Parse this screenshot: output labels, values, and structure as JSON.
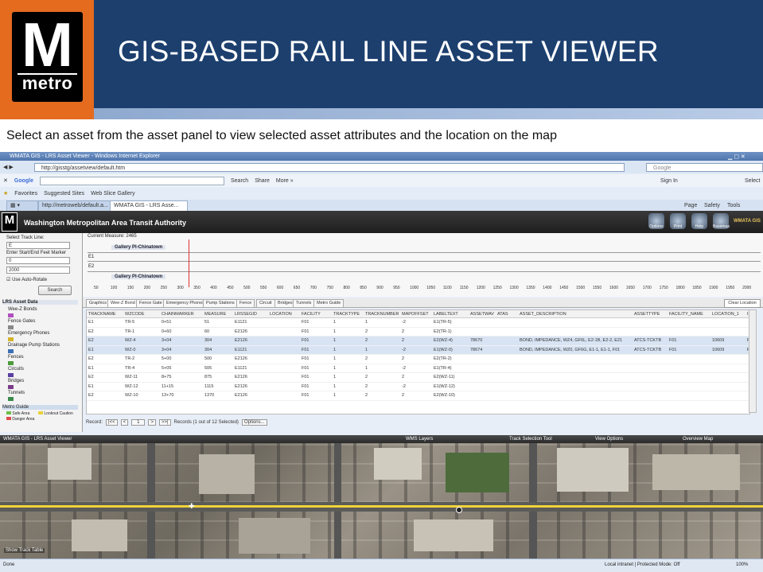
{
  "slide": {
    "title": "GIS-BASED RAIL LINE ASSET VIEWER",
    "subtitle": "Select an asset from the asset panel to view selected asset attributes and the location on the map",
    "logo": {
      "letter": "M",
      "word": "metro"
    },
    "colors": {
      "banner": "#1c3f6e",
      "orange": "#e56b1f",
      "light_bar": "#8fa9cf"
    }
  },
  "browser": {
    "window_title": "WMATA GIS - LRS Asset Viewer - Windows Internet Explorer",
    "address": "http://gisstg/assetview/default.htm",
    "search_placeholder": "Google",
    "google_bar": [
      "Google",
      "Search",
      "Share",
      "More »"
    ],
    "google_right": [
      "Sign In",
      "Select"
    ],
    "favorites": [
      "Favorites",
      "Suggested Sites",
      "Web Slice Gallery"
    ],
    "tabs": [
      "http://metroweb/default.a...",
      "WMATA GIS - LRS Asse..."
    ],
    "toolbar_right": [
      "Page",
      "Safety",
      "Tools"
    ]
  },
  "app": {
    "logo_letter": "M",
    "title": "Washington Metropolitan Area Transit Authority",
    "header_buttons": [
      "Options",
      "Print",
      "Help",
      "Basemap"
    ],
    "badge": "WMATA GIS"
  },
  "left_panel": {
    "select_track_label": "Select Track Line:",
    "track_value": "E",
    "marker_label": "Enter Start/End Feet Marker",
    "start_value": "0",
    "end_value": "2000",
    "auto_rotate": "Use Auto-Rotate",
    "search_btn": "Search",
    "assets_header": "LRS Asset Data",
    "legend": [
      {
        "label": "Wee-Z Bonds",
        "color": "#b14fc1"
      },
      {
        "label": "Fence Gates",
        "color": "#888888"
      },
      {
        "label": "Emergency Phones",
        "color": "#d4b32a"
      },
      {
        "label": "Drainage Pump Stations",
        "color": "#3a6fb5"
      },
      {
        "label": "Fences",
        "color": "#4a9b3a"
      },
      {
        "label": "Circuits",
        "color": "#5a3fa0"
      },
      {
        "label": "Bridges",
        "color": "#7a3a8a"
      },
      {
        "label": "Tunnels",
        "color": "#3a8a4a"
      }
    ],
    "metro_guide": "Metro Guide",
    "guide_items": [
      "Safe Area",
      "Lookout Caution",
      "Danger Area"
    ]
  },
  "track_panel": {
    "current_measure": "Current Measure: 2465",
    "label_top": "Gallery Pl-Chinatown",
    "lane1": "E1",
    "lane2": "E2",
    "label_bottom": "Gallery Pl-Chinatown",
    "ruler": [
      "50",
      "100",
      "150",
      "200",
      "250",
      "300",
      "350",
      "400",
      "450",
      "500",
      "550",
      "600",
      "650",
      "700",
      "750",
      "800",
      "850",
      "900",
      "950",
      "1000",
      "1050",
      "1100",
      "1150",
      "1200",
      "1250",
      "1300",
      "1350",
      "1400",
      "1450",
      "1500",
      "1550",
      "1600",
      "1650",
      "1700",
      "1750",
      "1800",
      "1850",
      "1900",
      "1950",
      "2000"
    ]
  },
  "asset_table": {
    "tabs": [
      "Graphics",
      "Wee-Z Bond",
      "Fence Gate",
      "Emergency Phones",
      "Pump Stations",
      "Fence",
      "Circuit",
      "Bridges",
      "Tunnels",
      "Metro Guide"
    ],
    "active_tab": 1,
    "location_btn": "Clear Location",
    "columns": [
      "TRACKNAME",
      "WZCODE",
      "CHAINMARKER",
      "MEASURE",
      "LRSSEGID",
      "LOCATION",
      "FACILITY",
      "TRACKTYPE",
      "TRACKNUMBER",
      "MAPOFFSET",
      "LABELTEXT",
      "ASSETWAV",
      "ATAS",
      "ASSET_DESCRIPTION",
      "ASSETTYPE",
      "FACILITY_NAME",
      "LOCATION_1",
      "ID"
    ],
    "rows": [
      [
        "E1",
        "TR-5",
        "0+51",
        "51",
        "E1121",
        "",
        "F01",
        "1",
        "1",
        "-2",
        "E1(TR-5)",
        "",
        "",
        "",
        "",
        "",
        "",
        ""
      ],
      [
        "E2",
        "TR-1",
        "0+60",
        "60",
        "E2126",
        "",
        "F01",
        "1",
        "2",
        "2",
        "E2(TR-1)",
        "",
        "",
        "",
        "",
        "",
        "",
        ""
      ],
      [
        "E2",
        "WZ-4",
        "3+04",
        "304",
        "E2126",
        "",
        "F01",
        "1",
        "2",
        "2",
        "E2(WZ-4)",
        "78670",
        "",
        "BOND, IMPEDANCE, WZ4, GF6L, E2-1B, E2-2, E21",
        "ATCS-TCKTB",
        "F01",
        "10609",
        "FD"
      ],
      [
        "E1",
        "WZ-0",
        "3+04",
        "304",
        "E1121",
        "",
        "F01",
        "1",
        "1",
        "-2",
        "E1(WZ-0)",
        "78674",
        "",
        "BOND, IMPEDANCE, WZ0, GF6G, E1-1, E1-1, F01",
        "ATCS-TCKTB",
        "F01",
        "10609",
        "FD"
      ],
      [
        "E2",
        "TR-2",
        "5+00",
        "500",
        "E2126",
        "",
        "F01",
        "1",
        "2",
        "2",
        "E2(TR-2)",
        "",
        "",
        "",
        "",
        "",
        "",
        ""
      ],
      [
        "E1",
        "TR-4",
        "5+05",
        "505",
        "E1121",
        "",
        "F01",
        "1",
        "1",
        "-2",
        "E1(TR-4)",
        "",
        "",
        "",
        "",
        "",
        "",
        ""
      ],
      [
        "E2",
        "WZ-11",
        "8+75",
        "875",
        "E2126",
        "",
        "F01",
        "1",
        "2",
        "2",
        "E2(WZ-11)",
        "",
        "",
        "",
        "",
        "",
        "",
        ""
      ],
      [
        "E1",
        "WZ-12",
        "11+15",
        "1115",
        "E2126",
        "",
        "F01",
        "1",
        "2",
        "-2",
        "E1(WZ-12)",
        "",
        "",
        "",
        "",
        "",
        "",
        ""
      ],
      [
        "E2",
        "WZ-10",
        "13+70",
        "1370",
        "E2126",
        "",
        "F01",
        "1",
        "2",
        "2",
        "E2(WZ-10)",
        "",
        "",
        "",
        "",
        "",
        "",
        ""
      ]
    ],
    "selected_rows": [
      2,
      3
    ],
    "pager": {
      "record": "Record:",
      "first": "|<<",
      "prev": "<",
      "current": "1",
      "next": ">",
      "last": ">>|",
      "summary": "Records (1 out of 12 Selected)",
      "options": "Options..."
    }
  },
  "map": {
    "bar_title": "WMATA GIS - LRS Asset Viewer",
    "bar_items": [
      "WMS Layers",
      "Track Selection Tool",
      "View Options",
      "Overview Map"
    ],
    "label": "Show Track Table"
  },
  "status_bar": {
    "left": "Done",
    "zone": "Local intranet | Protected Mode: Off",
    "zoom": "100%"
  }
}
